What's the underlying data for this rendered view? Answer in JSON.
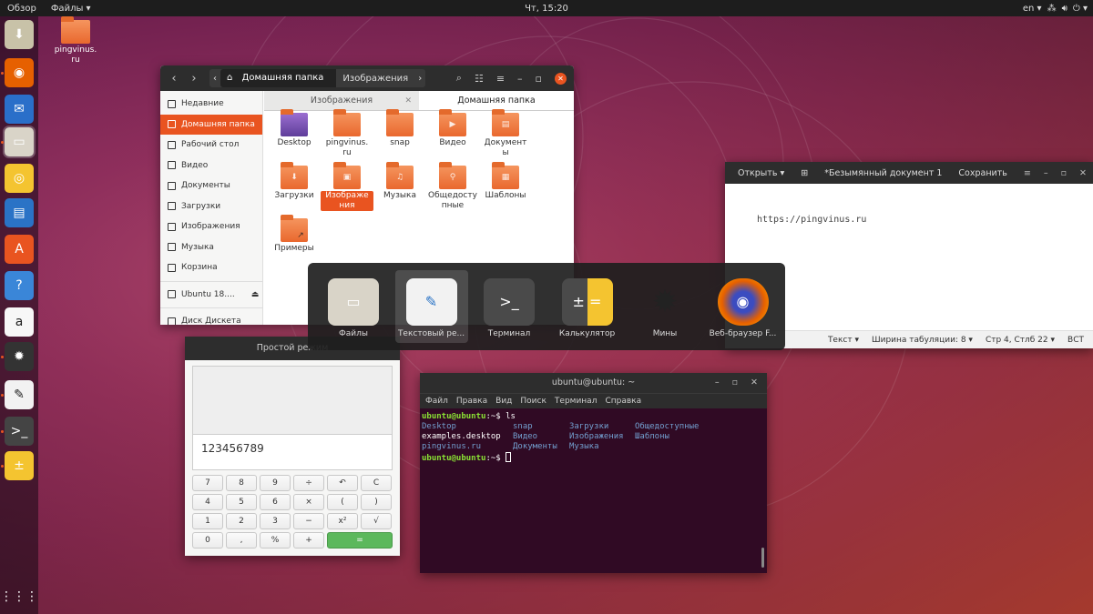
{
  "topbar": {
    "activities": "Обзор",
    "app_menu": "Файлы",
    "clock": "Чт, 15:20",
    "lang": "en"
  },
  "dock": {
    "items": [
      {
        "name": "install-icon",
        "color": "#c8c2a8"
      },
      {
        "name": "firefox-icon",
        "color": "#e66000"
      },
      {
        "name": "thunderbird-icon",
        "color": "#2a6fc9"
      },
      {
        "name": "files-icon",
        "color": "#d9d4c8"
      },
      {
        "name": "rhythmbox-icon",
        "color": "#f4c430"
      },
      {
        "name": "writer-icon",
        "color": "#2a73c6"
      },
      {
        "name": "software-icon",
        "color": "#e95420"
      },
      {
        "name": "help-icon",
        "color": "#3a86d8"
      },
      {
        "name": "amazon-icon",
        "color": "#f7f7f7"
      },
      {
        "name": "mines-icon",
        "color": "#333333"
      },
      {
        "name": "text-editor-icon",
        "color": "#f2f2f2"
      },
      {
        "name": "terminal-icon",
        "color": "#444444"
      },
      {
        "name": "calculator-icon",
        "color": "#f4c430"
      }
    ],
    "apps_grid": "show-apps-icon"
  },
  "desktop": {
    "icon_label": "pingvinus.\nru"
  },
  "files": {
    "path_home": "Домашняя папка",
    "path_images": "Изображения",
    "sidebar": [
      "Недавние",
      "Домашняя папка",
      "Рабочий стол",
      "Видео",
      "Документы",
      "Загрузки",
      "Изображения",
      "Музыка",
      "Корзина"
    ],
    "devices": [
      "Ubuntu 18....",
      "Диск Дискета"
    ],
    "tabs": [
      "Изображения",
      "Домашняя папка"
    ],
    "items": [
      "Desktop",
      "pingvinus.\nru",
      "snap",
      "Видео",
      "Документ\nы",
      "Загрузки",
      "Изображе\nния",
      "Музыка",
      "Общедосту\nпные",
      "Шаблоны",
      "Примеры"
    ]
  },
  "editor": {
    "open": "Открыть",
    "title": "*Безымянный документ 1",
    "save": "Сохранить",
    "text": "https://pingvinus.ru",
    "status": [
      "Текст",
      "Ширина табуляции: 8",
      "Стр 4, Стлб 22",
      "ВСТ"
    ]
  },
  "calculator": {
    "title": "Простой режим",
    "display": "123456789",
    "keys": [
      [
        "7",
        "8",
        "9",
        "÷",
        "↶",
        "C"
      ],
      [
        "4",
        "5",
        "6",
        "×",
        "(",
        ")"
      ],
      [
        "1",
        "2",
        "3",
        "−",
        "x²",
        "√"
      ],
      [
        "0",
        ",",
        "%",
        "+",
        "="
      ]
    ]
  },
  "terminal": {
    "title": "ubuntu@ubuntu: ~",
    "menu": [
      "Файл",
      "Правка",
      "Вид",
      "Поиск",
      "Терминал",
      "Справка"
    ],
    "prompt": "ubuntu@ubuntu",
    "cmd": "ls",
    "cols": [
      [
        "Desktop",
        "examples.desktop",
        "pingvinus.ru"
      ],
      [
        "snap",
        "Видео",
        "Документы"
      ],
      [
        "Загрузки",
        "Изображения",
        "Музыка"
      ],
      [
        "Общедоступные",
        "Шаблоны"
      ]
    ]
  },
  "switcher": {
    "items": [
      "Файлы",
      "Текстовый ре...",
      "Терминал",
      "Калькулятор",
      "Мины",
      "Веб-браузер F..."
    ]
  }
}
